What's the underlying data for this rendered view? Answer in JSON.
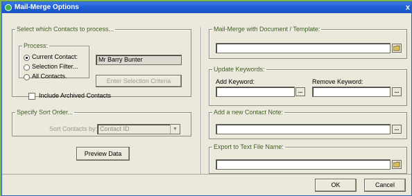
{
  "window": {
    "title": "Mail-Merge Options",
    "close_glyph": "x"
  },
  "contacts": {
    "legend": "Select which Contacts to process...",
    "process_legend": "Process:",
    "options": [
      "Current Contact:",
      "Selection Filter...",
      "All Contacts."
    ],
    "selected_option": "Current Contact:",
    "current_contact_value": "Mr Barry Bunter",
    "selection_criteria_button": "Enter Selection Criteria",
    "include_archived_label": "Include Archived Contacts",
    "include_archived_checked": false
  },
  "sort": {
    "legend": "Specify Sort Order...",
    "sort_by_label": "Sort Contacts by:",
    "sort_by_value": "Contact ID"
  },
  "preview_button": "Preview Data",
  "mail_merge": {
    "legend": "Mail-Merge with Document / Template:",
    "value": ""
  },
  "keywords": {
    "legend": "Update Keywords:",
    "add_label": "Add Keyword:",
    "remove_label": "Remove Keyword:",
    "add_value": "",
    "remove_value": "",
    "browse_glyph": "..."
  },
  "contact_note": {
    "legend": "Add a new Contact Note:",
    "value": "",
    "browse_glyph": "..."
  },
  "export": {
    "legend": "Export to Text File Name:",
    "value": ""
  },
  "footer": {
    "ok_label": "OK",
    "cancel_label": "Cancel"
  },
  "icons": {
    "app": "app-icon",
    "folder": "folder-icon",
    "dropdown": "chevron-down-icon"
  },
  "colors": {
    "title_bar": "#1f5fd6",
    "legend_text": "#3a5a1a",
    "dialog_bg": "#ebe9dc",
    "backdrop": "#7fb84a"
  }
}
